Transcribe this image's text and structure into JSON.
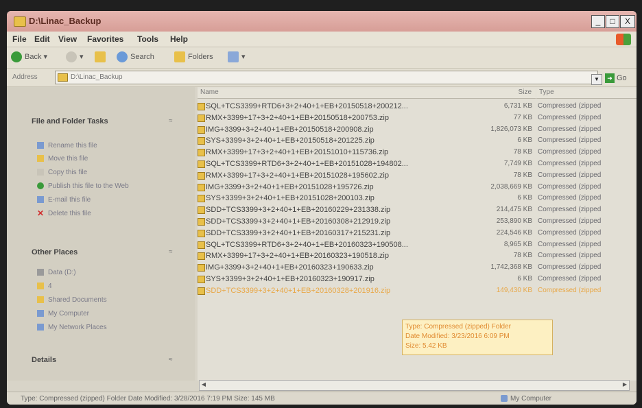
{
  "window": {
    "title": "D:\\Linac_Backup",
    "min": "_",
    "max": "□",
    "close": "X"
  },
  "menu": [
    "File",
    "Edit",
    "View",
    "Favorites",
    "Tools",
    "Help"
  ],
  "toolbar": {
    "back": "Back",
    "search": "Search",
    "folders": "Folders"
  },
  "address": {
    "label": "Address",
    "value": "D:\\Linac_Backup",
    "go": "Go"
  },
  "sidebar": {
    "tasks_title": "File and Folder Tasks",
    "tasks": [
      "Rename this file",
      "Move this file",
      "Copy this file",
      "Publish this file to the Web",
      "E-mail this file",
      "Delete this file"
    ],
    "places_title": "Other Places",
    "places": [
      "Data (D:)",
      "4",
      "Shared Documents",
      "My Computer",
      "My Network Places"
    ],
    "details_title": "Details"
  },
  "columns": {
    "name": "Name",
    "size": "Size",
    "type": "Type"
  },
  "files": [
    {
      "name": "SQL+TCS3399+RTD6+3+2+40+1+EB+20150518+200212...",
      "size": "6,731 KB",
      "type": "Compressed (zipped"
    },
    {
      "name": "RMX+3399+17+3+2+40+1+EB+20150518+200753.zip",
      "size": "77 KB",
      "type": "Compressed (zipped"
    },
    {
      "name": "IMG+3399+3+2+40+1+EB+20150518+200908.zip",
      "size": "1,826,073 KB",
      "type": "Compressed (zipped"
    },
    {
      "name": "SYS+3399+3+2+40+1+EB+20150518+201225.zip",
      "size": "6 KB",
      "type": "Compressed (zipped"
    },
    {
      "name": "RMX+3399+17+3+2+40+1+EB+20151010+115736.zip",
      "size": "78 KB",
      "type": "Compressed (zipped"
    },
    {
      "name": "SQL+TCS3399+RTD6+3+2+40+1+EB+20151028+194802...",
      "size": "7,749 KB",
      "type": "Compressed (zipped"
    },
    {
      "name": "RMX+3399+17+3+2+40+1+EB+20151028+195602.zip",
      "size": "78 KB",
      "type": "Compressed (zipped"
    },
    {
      "name": "IMG+3399+3+2+40+1+EB+20151028+195726.zip",
      "size": "2,038,669 KB",
      "type": "Compressed (zipped"
    },
    {
      "name": "SYS+3399+3+2+40+1+EB+20151028+200103.zip",
      "size": "6 KB",
      "type": "Compressed (zipped"
    },
    {
      "name": "SDD+TCS3399+3+2+40+1+EB+20160229+231338.zip",
      "size": "214,475 KB",
      "type": "Compressed (zipped"
    },
    {
      "name": "SDD+TCS3399+3+2+40+1+EB+20160308+212919.zip",
      "size": "253,890 KB",
      "type": "Compressed (zipped"
    },
    {
      "name": "SDD+TCS3399+3+2+40+1+EB+20160317+215231.zip",
      "size": "224,546 KB",
      "type": "Compressed (zipped"
    },
    {
      "name": "SQL+TCS3399+RTD6+3+2+40+1+EB+20160323+190508...",
      "size": "8,965 KB",
      "type": "Compressed (zipped"
    },
    {
      "name": "RMX+3399+17+3+2+40+1+EB+20160323+190518.zip",
      "size": "78 KB",
      "type": "Compressed (zipped"
    },
    {
      "name": "IMG+3399+3+2+40+1+EB+20160323+190633.zip",
      "size": "1,742,368 KB",
      "type": "Compressed (zipped"
    },
    {
      "name": "SYS+3399+3+2+40+1+EB+20160323+190917.zip",
      "size": "6 KB",
      "type": "Compressed (zipped"
    },
    {
      "name": "SDD+TCS3399+3+2+40+1+EB+20160328+201916.zip",
      "size": "149,430 KB",
      "type": "Compressed (zipped"
    }
  ],
  "tooltip": {
    "type": "Type: Compressed (zipped) Folder",
    "date": "Date Modified: 3/23/2016 6:09 PM",
    "size": "Size: 5.42 KB"
  },
  "status": {
    "text": "Type: Compressed (zipped) Folder Date Modified: 3/28/2016 7:19 PM Size: 145 MB",
    "location": "My Computer"
  }
}
